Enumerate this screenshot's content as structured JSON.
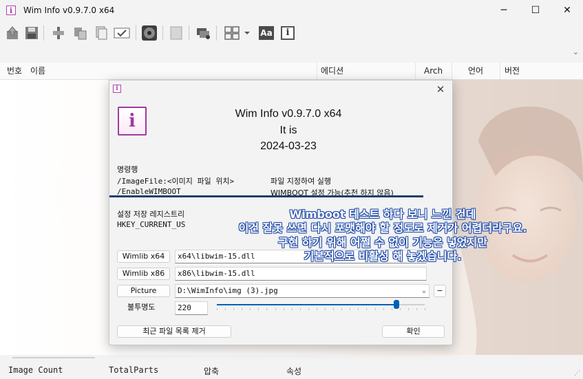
{
  "window": {
    "title": "Wim Info v0.9.7.0 x64",
    "icon_glyph": "i",
    "minimize": "─",
    "maximize": "☐",
    "close": "✕"
  },
  "toolbar": {
    "icons": [
      "export-icon",
      "save-icon",
      "split-icon",
      "copy-icon",
      "copy-pages-icon",
      "check-icon",
      "disc-icon",
      "blank-icon",
      "projector-icon",
      "grid-icon",
      "font-icon",
      "info-icon"
    ],
    "font_label": "Aa",
    "info_label": "i"
  },
  "list": {
    "columns": [
      "번호",
      "이름",
      "에디션",
      "Arch",
      "언어",
      "버전"
    ]
  },
  "status": {
    "image_count": "Image Count",
    "total_parts": "TotalParts",
    "compression": "압축",
    "attributes": "속성"
  },
  "dialog": {
    "icon_glyph": "i",
    "close": "✕",
    "app_name": "Wim Info v0.9.7.0 x64",
    "tagline": "It is",
    "date": "2024-03-23",
    "cmd_header": "명령행",
    "cmd1_arg": "/ImageFile:<이미지 파일 위치>",
    "cmd1_desc": "파일 지정하여 실행",
    "cmd2_arg": "/EnableWIMBOOT",
    "cmd2_desc": "WIMBOOT 설정 가능(추천 하지 않음)",
    "registry_header": "설정 저장 레지스트리",
    "registry_path": "HKEY_CURRENT_US",
    "wimlib_x64_label": "Wimlib x64",
    "wimlib_x64_value": "x64\\libwim-15.dll",
    "wimlib_x86_label": "Wimlib x86",
    "wimlib_x86_value": "x86\\libwim-15.dll",
    "picture_label": "Picture",
    "picture_value": "D:\\WimInfo\\img (3).jpg",
    "picture_minus": "−",
    "opacity_label": "불투명도",
    "opacity_value": "220",
    "opacity_max": 255,
    "clear_recent_label": "최근 파일 목록 제거",
    "ok_label": "확인"
  },
  "overlay": {
    "line1": "Wimboot 테스트 하다 보니 느낀 건데",
    "line2": "이건 잘못 쓰면 다시 포맷해야 할 정도로 제거가 어렵더라구요.",
    "line3": "구현 하기 위해 어쩔 수 없이 기능은 넣었지만",
    "line4": "기본적으로 비활성 해 놓겠습니다."
  },
  "colors": {
    "accent": "#005fb8",
    "icon_purple": "#a03aa0",
    "divider_blue": "#1d3f6e",
    "overlay_outline": "#1f4aa8"
  }
}
